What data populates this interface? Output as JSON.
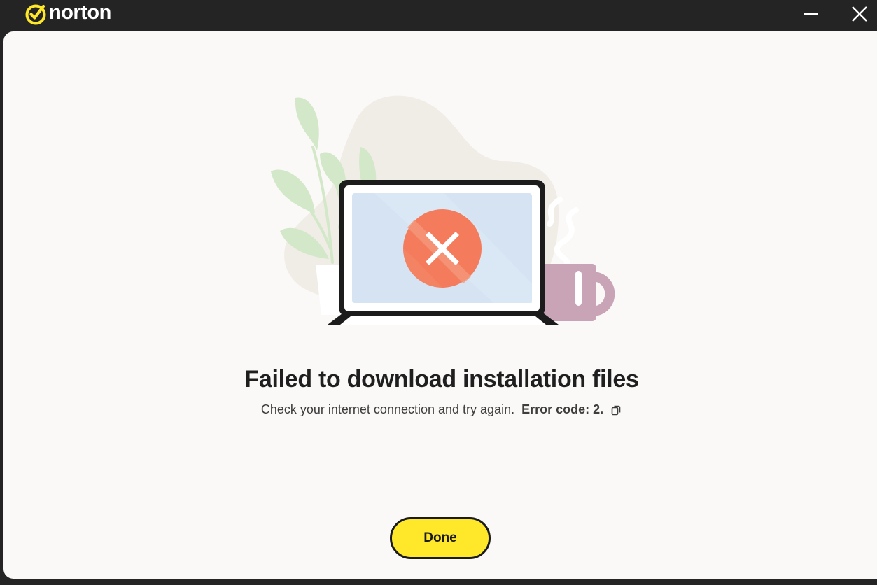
{
  "app": {
    "brand_name": "norton",
    "brand_color": "#ffe82a",
    "titlebar_color": "#242424"
  },
  "window_controls": {
    "minimize_icon": "minimize-icon",
    "close_icon": "close-icon"
  },
  "illustration": {
    "screen_color": "#d5e3f2",
    "error_circle_color": "#f47c5c",
    "mug_color": "#c9a3b6",
    "plant_color": "#d3e8c8",
    "error_icon": "x-mark-icon"
  },
  "message": {
    "title": "Failed to download installation files",
    "body": "Check your internet connection and try again.",
    "error_code": "Error code: 2.",
    "copy_icon": "copy-icon"
  },
  "actions": {
    "done_label": "Done"
  }
}
